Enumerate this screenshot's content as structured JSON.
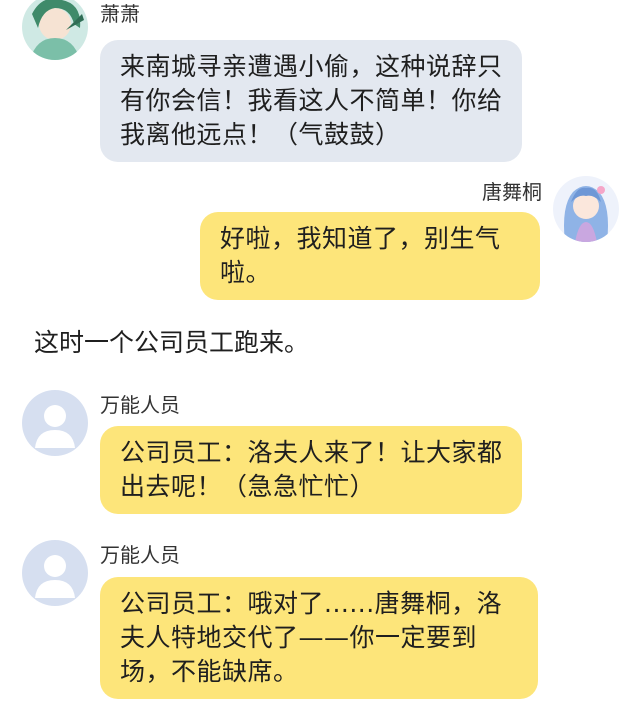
{
  "messages": [
    {
      "speaker": "萧萧",
      "text": "来南城寻亲遭遇小偷，这种说辞只有你会信！我看这人不简单！你给我离他远点！（气鼓鼓）",
      "avatar_icon": "anime-girl-avatar-icon",
      "side": "left",
      "bubble_color": "#e3e8f0"
    },
    {
      "speaker": "唐舞桐",
      "text": "好啦，我知道了，别生气啦。",
      "avatar_icon": "anime-girl-blue-hair-avatar-icon",
      "side": "right",
      "bubble_color": "#fde57a"
    },
    {
      "speaker": "万能人员",
      "text": "公司员工：洛夫人来了！让大家都出去呢！（急急忙忙）",
      "avatar_icon": "default-user-avatar-icon",
      "side": "left",
      "bubble_color": "#fde57a"
    },
    {
      "speaker": "万能人员",
      "text": "公司员工：哦对了......唐舞桐，洛夫人特地交代了——你一定要到场，不能缺席。",
      "avatar_icon": "default-user-avatar-icon",
      "side": "left",
      "bubble_color": "#fde57a"
    }
  ],
  "narration": "这时一个公司员工跑来。"
}
